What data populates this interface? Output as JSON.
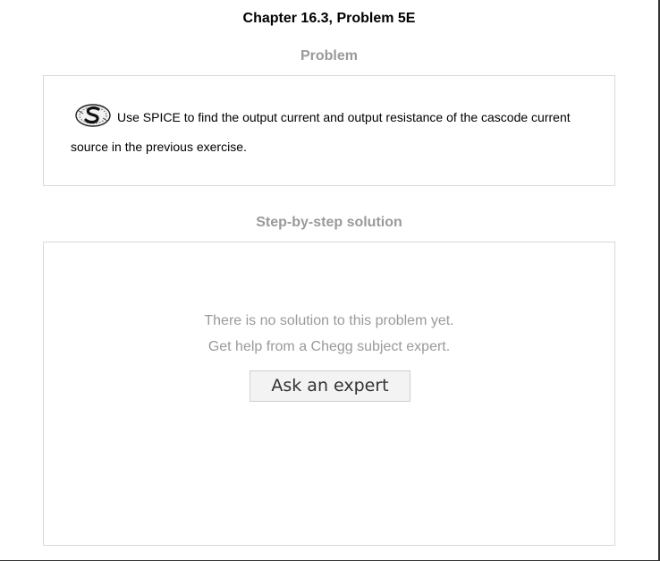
{
  "header": {
    "chapter_title": "Chapter 16.3, Problem 5E"
  },
  "problem": {
    "heading": "Problem",
    "icon": "spice-icon",
    "text": "Use SPICE to find the output current and output resistance of the cascode current source in the previous exercise."
  },
  "solution": {
    "heading": "Step-by-step solution",
    "message_line1": "There is no solution to this problem yet.",
    "message_line2": "Get help from a Chegg subject expert.",
    "ask_button_label": "Ask an expert"
  }
}
